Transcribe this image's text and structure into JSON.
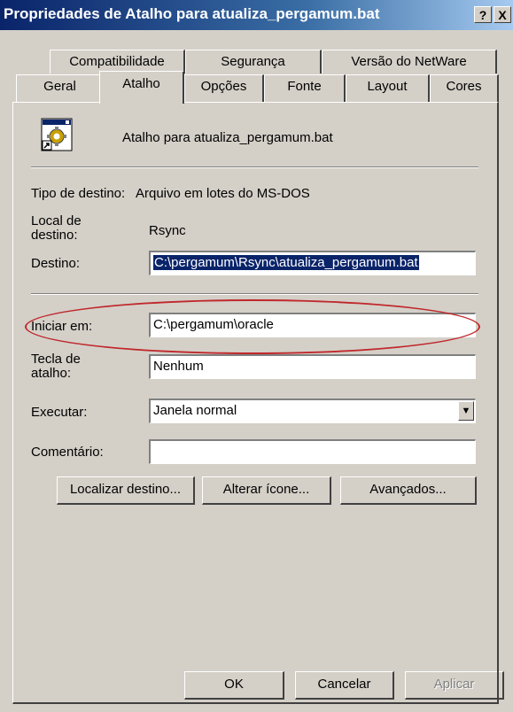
{
  "window": {
    "title": "Propriedades de Atalho para atualiza_pergamum.bat",
    "help_btn": "?",
    "close_btn": "X"
  },
  "tabs": {
    "row_back": [
      "Compatibilidade",
      "Segurança",
      "Versão do NetWare"
    ],
    "row_front": [
      "Geral",
      "Atalho",
      "Opções",
      "Fonte",
      "Layout",
      "Cores"
    ],
    "active": "Atalho"
  },
  "shortcut": {
    "name": "Atalho para atualiza_pergamum.bat",
    "icon": "batch-file-shortcut-icon"
  },
  "fields": {
    "tipo_label": "Tipo de destino:",
    "tipo_value": "Arquivo em lotes do MS-DOS",
    "local_label": "Local de destino:",
    "local_value": "Rsync",
    "destino_label": "Destino:",
    "destino_value": "C:\\pergamum\\Rsync\\atualiza_pergamum.bat",
    "iniciar_label": "Iniciar em:",
    "iniciar_value": "C:\\pergamum\\oracle",
    "tecla_label": "Tecla de atalho:",
    "tecla_value": "Nenhum",
    "executar_label": "Executar:",
    "executar_value": "Janela normal",
    "comentario_label": "Comentário:",
    "comentario_value": ""
  },
  "buttons": {
    "localizar": "Localizar destino...",
    "alterar": "Alterar ícone...",
    "avancados": "Avançados...",
    "ok": "OK",
    "cancelar": "Cancelar",
    "aplicar": "Aplicar"
  },
  "colors": {
    "face": "#d4d0c8",
    "title_start": "#0a246a",
    "title_end": "#a6caf0",
    "selection": "#0a246a",
    "annotation": "#c0282c"
  }
}
